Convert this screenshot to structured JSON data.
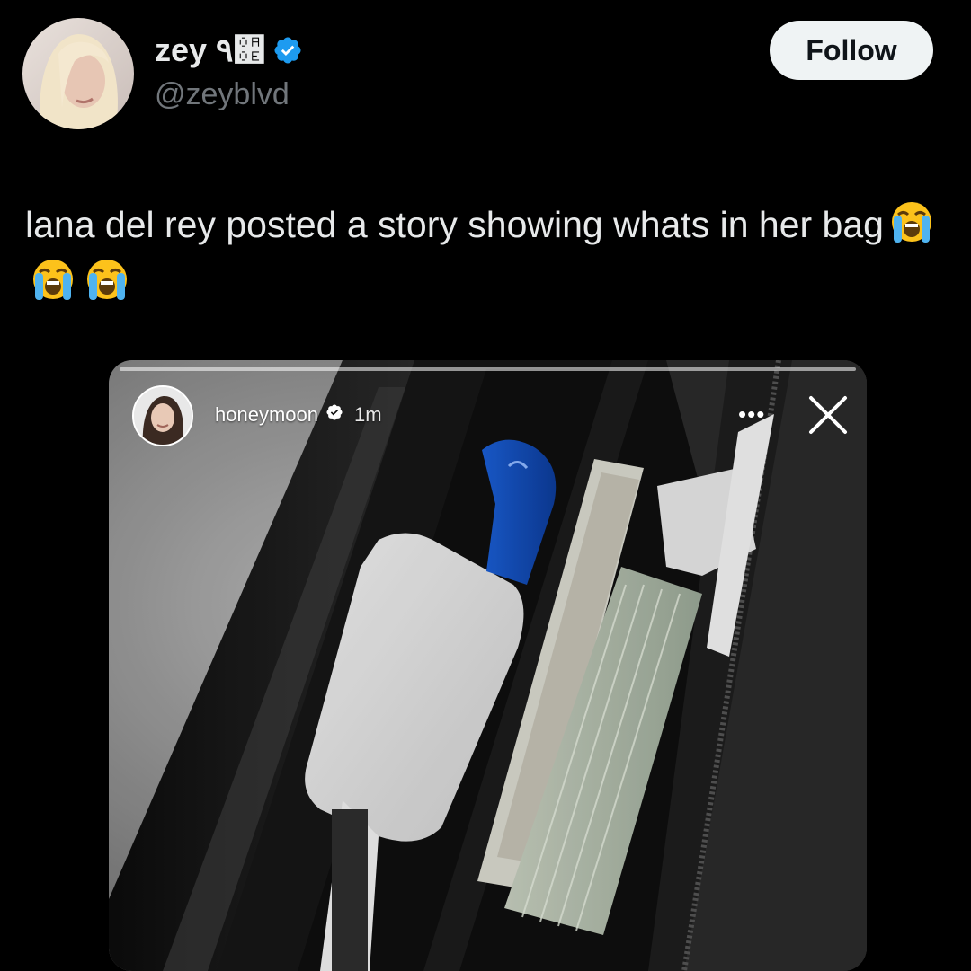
{
  "user": {
    "display_name": "zey ٩਎",
    "handle": "@zeyblvd",
    "verified": true
  },
  "follow_button": {
    "label": "Follow"
  },
  "tweet": {
    "text": "lana del rey posted a story showing whats in her bag",
    "emojis": [
      "loudly-crying-face",
      "loudly-crying-face",
      "loudly-crying-face"
    ]
  },
  "story": {
    "username": "honeymoon",
    "verified": true,
    "time": "1m",
    "more_icon": "more-horizontal-icon",
    "close_icon": "close-icon",
    "content": "photo of open handbag with white earbuds case, blue lipstick/lighter, rolled cash and receipts"
  },
  "colors": {
    "background": "#000000",
    "text_primary": "#e7e9ea",
    "text_secondary": "#71767b",
    "verified_blue": "#1d9bf0",
    "follow_bg": "#eff3f4"
  }
}
